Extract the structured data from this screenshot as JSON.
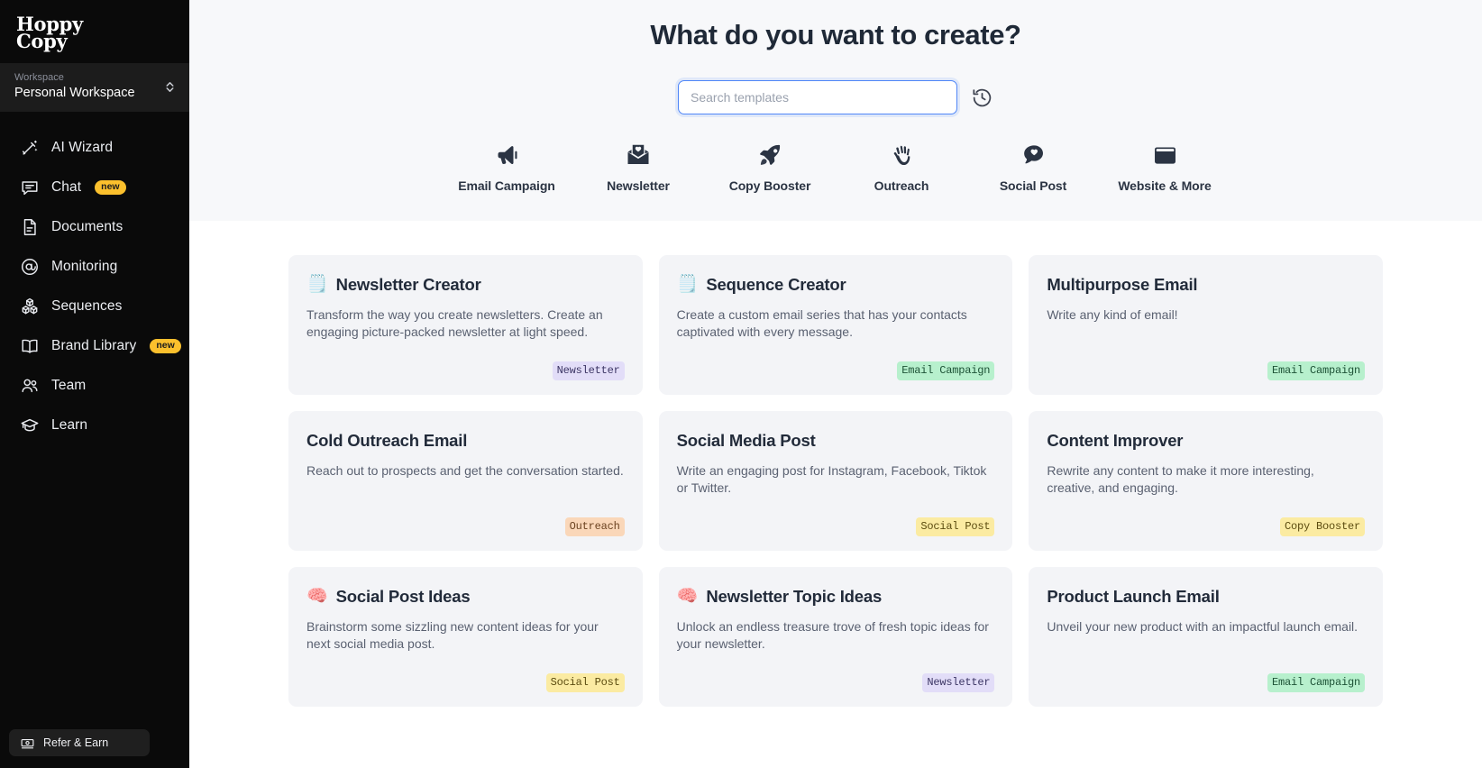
{
  "sidebar": {
    "logo_line1": "Hoppy",
    "logo_line2": "Copy",
    "workspace_label": "Workspace",
    "workspace_name": "Personal Workspace",
    "items": [
      {
        "label": "AI Wizard",
        "icon": "magic-wand-icon",
        "badge": ""
      },
      {
        "label": "Chat",
        "icon": "chat-bubble-icon",
        "badge": "new"
      },
      {
        "label": "Documents",
        "icon": "document-icon",
        "badge": ""
      },
      {
        "label": "Monitoring",
        "icon": "at-circle-icon",
        "badge": ""
      },
      {
        "label": "Sequences",
        "icon": "blocks-icon",
        "badge": ""
      },
      {
        "label": "Brand Library",
        "icon": "open-book-icon",
        "badge": "new"
      },
      {
        "label": "Team",
        "icon": "users-icon",
        "badge": ""
      },
      {
        "label": "Learn",
        "icon": "graduation-cap-icon",
        "badge": ""
      }
    ],
    "refer_label": "Refer & Earn",
    "refer_icon": "money-icon"
  },
  "hero": {
    "title": "What do you want to create?",
    "search_placeholder": "Search templates",
    "search_value": "",
    "history_icon": "history-clock-icon",
    "categories": [
      {
        "label": "Email Campaign",
        "icon": "megaphone-icon"
      },
      {
        "label": "Newsletter",
        "icon": "envelope-heart-icon"
      },
      {
        "label": "Copy Booster",
        "icon": "rocket-icon"
      },
      {
        "label": "Outreach",
        "icon": "waving-hand-icon"
      },
      {
        "label": "Social Post",
        "icon": "speech-heart-icon"
      },
      {
        "label": "Website & More",
        "icon": "browser-window-icon"
      }
    ]
  },
  "colors": {
    "accent_blue": "#4f86f7",
    "sidebar_bg": "#0a0a0a",
    "hero_bg": "#f7f8fa",
    "card_bg": "#f3f4f7",
    "badge_newsletter_bg": "#e2ddf8",
    "badge_newsletter_fg": "#3b3564",
    "badge_email_campaign_bg": "#b7f0cd",
    "badge_email_campaign_fg": "#1d5236",
    "badge_outreach_bg": "#fad7b9",
    "badge_outreach_fg": "#6b4220",
    "badge_social_post_bg": "#fbeba2",
    "badge_social_post_fg": "#5c4c10",
    "badge_copy_booster_bg": "#fbeba2",
    "badge_copy_booster_fg": "#5c4c10",
    "pill_new_bg": "#fbc02d"
  },
  "templates": [
    {
      "emoji": "🗒️",
      "title": "Newsletter Creator",
      "description": "Transform the way you create newsletters. Create an engaging picture-packed newsletter at light speed.",
      "badge": "Newsletter",
      "badge_bg": "#e2ddf8",
      "badge_fg": "#3b3564"
    },
    {
      "emoji": "🗒️",
      "title": "Sequence Creator",
      "description": "Create a custom email series that has your contacts captivated with every message.",
      "badge": "Email Campaign",
      "badge_bg": "#b7f0cd",
      "badge_fg": "#1d5236"
    },
    {
      "emoji": "",
      "title": "Multipurpose Email",
      "description": "Write any kind of email!",
      "badge": "Email Campaign",
      "badge_bg": "#b7f0cd",
      "badge_fg": "#1d5236"
    },
    {
      "emoji": "",
      "title": "Cold Outreach Email",
      "description": "Reach out to prospects and get the conversation started.",
      "badge": "Outreach",
      "badge_bg": "#fad7b9",
      "badge_fg": "#6b4220"
    },
    {
      "emoji": "",
      "title": "Social Media Post",
      "description": "Write an engaging post for Instagram, Facebook, Tiktok or Twitter.",
      "badge": "Social Post",
      "badge_bg": "#fbeba2",
      "badge_fg": "#5c4c10"
    },
    {
      "emoji": "",
      "title": "Content Improver",
      "description": "Rewrite any content to make it more interesting, creative, and engaging.",
      "badge": "Copy Booster",
      "badge_bg": "#fbeba2",
      "badge_fg": "#5c4c10"
    },
    {
      "emoji": "🧠",
      "title": "Social Post Ideas",
      "description": "Brainstorm some sizzling new content ideas for your next social media post.",
      "badge": "Social Post",
      "badge_bg": "#fbeba2",
      "badge_fg": "#5c4c10"
    },
    {
      "emoji": "🧠",
      "title": "Newsletter Topic Ideas",
      "description": "Unlock an endless treasure trove of fresh topic ideas for your newsletter.",
      "badge": "Newsletter",
      "badge_bg": "#e2ddf8",
      "badge_fg": "#3b3564"
    },
    {
      "emoji": "",
      "title": "Product Launch Email",
      "description": "Unveil your new product with an impactful launch email.",
      "badge": "Email Campaign",
      "badge_bg": "#b7f0cd",
      "badge_fg": "#1d5236"
    }
  ]
}
